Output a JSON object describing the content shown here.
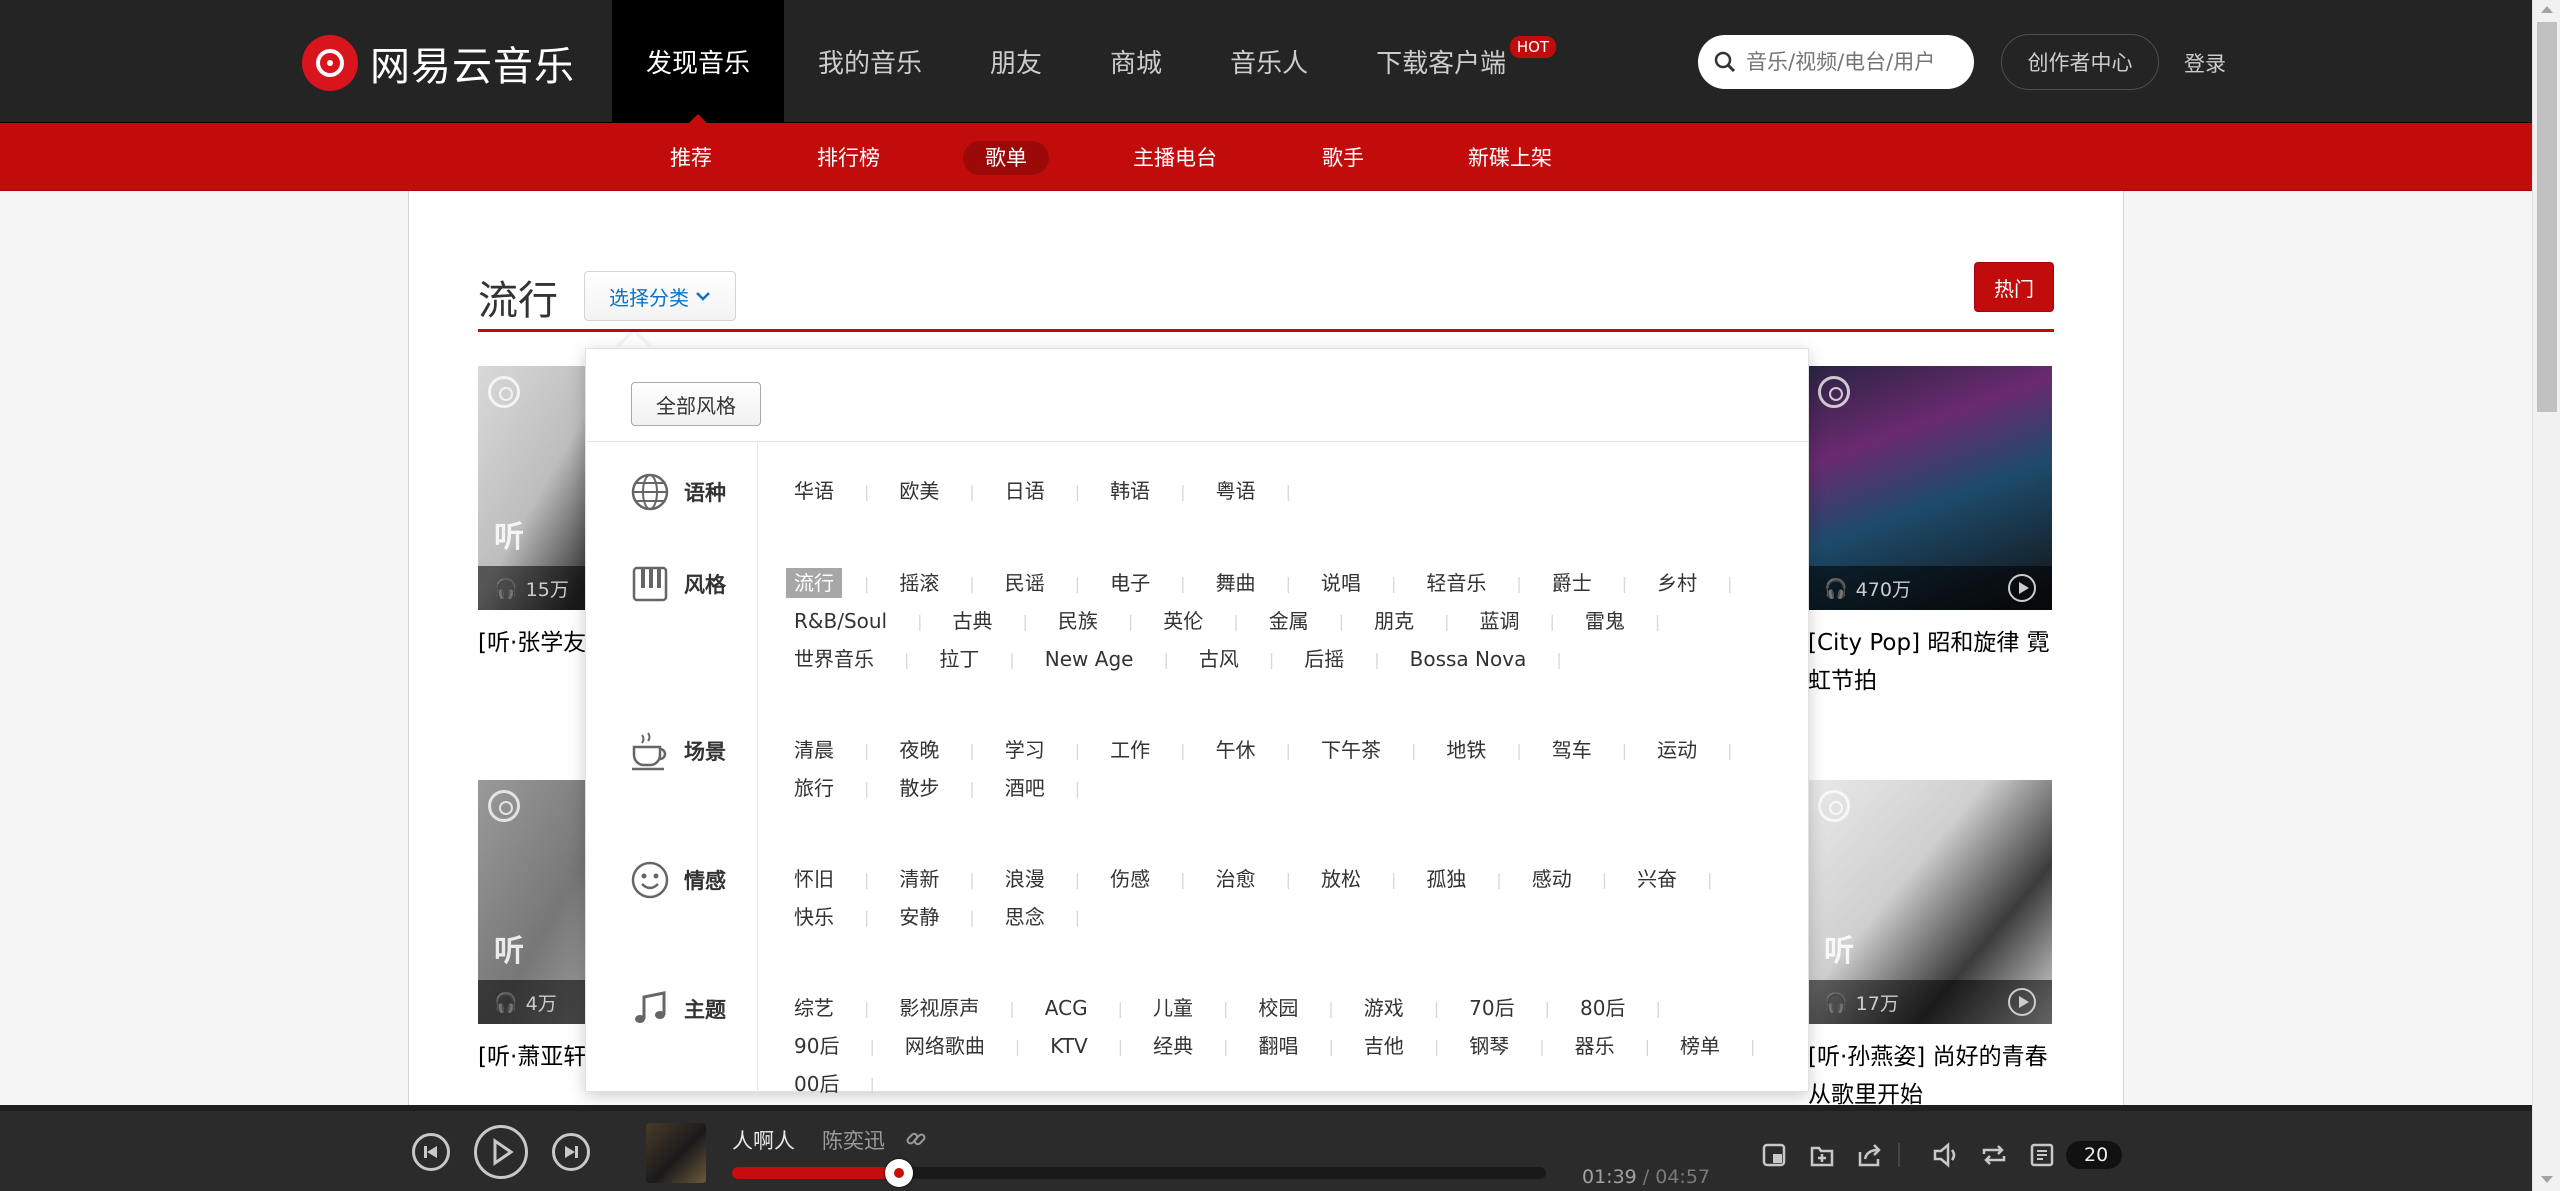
{
  "header": {
    "logo_text": "网易云音乐",
    "nav": [
      {
        "label": "发现音乐",
        "active": true
      },
      {
        "label": "我的音乐"
      },
      {
        "label": "朋友"
      },
      {
        "label": "商城"
      },
      {
        "label": "音乐人"
      },
      {
        "label": "下载客户端",
        "badge": "HOT"
      }
    ],
    "search_placeholder": "音乐/视频/电台/用户",
    "creator_center": "创作者中心",
    "login": "登录"
  },
  "subnav": {
    "items": [
      "推荐",
      "排行榜",
      "歌单",
      "主播电台",
      "歌手",
      "新碟上架"
    ],
    "active": "歌单"
  },
  "page": {
    "title": "流行",
    "category_button": "选择分类",
    "hot_button": "热门"
  },
  "cards": [
    {
      "overlay": "听",
      "count": "15万",
      "title": "[听·张学友] 慢慢听….."
    },
    {
      "overlay": "",
      "count": "470万",
      "title": "[City Pop] 昭和旋律 霓虹节拍"
    },
    {
      "overlay": "听",
      "count": "4万",
      "title": "[听·萧亚轩] 不爱不行"
    },
    {
      "overlay": "听",
      "count": "17万",
      "title": "[听·孙燕姿] 尚好的青春从歌里开始"
    }
  ],
  "dropdown": {
    "all_styles": "全部风格",
    "categories": [
      {
        "label": "语种",
        "icon": "globe-icon",
        "tags": [
          "华语",
          "欧美",
          "日语",
          "韩语",
          "粤语"
        ]
      },
      {
        "label": "风格",
        "icon": "piano-icon",
        "active": "流行",
        "tags": [
          "流行",
          "摇滚",
          "民谣",
          "电子",
          "舞曲",
          "说唱",
          "轻音乐",
          "爵士",
          "乡村",
          "R&B/Soul",
          "古典",
          "民族",
          "英伦",
          "金属",
          "朋克",
          "蓝调",
          "雷鬼",
          "世界音乐",
          "拉丁",
          "New Age",
          "古风",
          "后摇",
          "Bossa Nova"
        ]
      },
      {
        "label": "场景",
        "icon": "coffee-icon",
        "tags": [
          "清晨",
          "夜晚",
          "学习",
          "工作",
          "午休",
          "下午茶",
          "地铁",
          "驾车",
          "运动",
          "旅行",
          "散步",
          "酒吧"
        ]
      },
      {
        "label": "情感",
        "icon": "smile-icon",
        "tags": [
          "怀旧",
          "清新",
          "浪漫",
          "伤感",
          "治愈",
          "放松",
          "孤独",
          "感动",
          "兴奋",
          "快乐",
          "安静",
          "思念"
        ]
      },
      {
        "label": "主题",
        "icon": "music-note-icon",
        "tags": [
          "综艺",
          "影视原声",
          "ACG",
          "儿童",
          "校园",
          "游戏",
          "70后",
          "80后",
          "90后",
          "网络歌曲",
          "KTV",
          "经典",
          "翻唱",
          "吉他",
          "钢琴",
          "器乐",
          "榜单",
          "00后"
        ]
      }
    ]
  },
  "player": {
    "song": "人啊人",
    "artist": "陈奕迅",
    "current_time": "01:39",
    "total_time": "04:57",
    "progress": 0.205,
    "playlist_count": "20"
  },
  "colors": {
    "brand_red": "#c20c0c",
    "topbar": "#242424",
    "player": "#2b2b2b"
  }
}
